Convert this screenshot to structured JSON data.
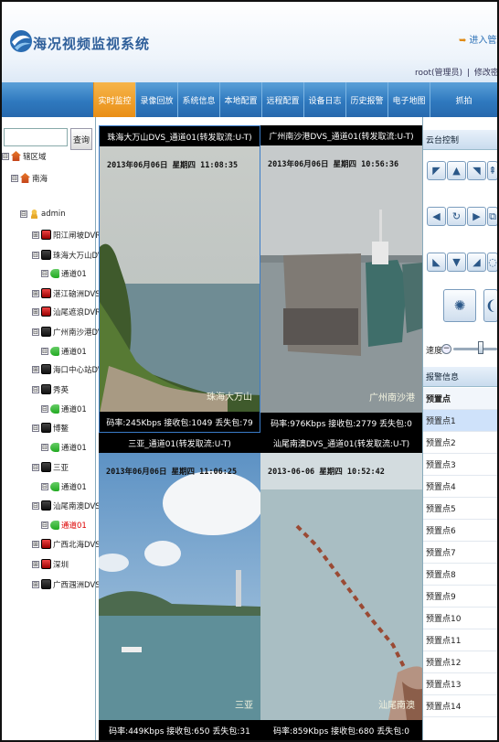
{
  "header": {
    "app_title": "海况视频监视系统",
    "enter_admin": "进入管理",
    "user_name": "root(管理员)",
    "change_password": "修改密码",
    "separator": "|"
  },
  "nav": {
    "tabs": [
      {
        "label": "实时监控",
        "active": true
      },
      {
        "label": "录像回放"
      },
      {
        "label": "系统信息"
      },
      {
        "label": "本地配置"
      },
      {
        "label": "远程配置"
      },
      {
        "label": "设备日志"
      },
      {
        "label": "历史报警"
      },
      {
        "label": "电子地图"
      },
      {
        "label": "抓拍"
      }
    ]
  },
  "left": {
    "search_placeholder": "",
    "search_button": "查询",
    "tree": [
      {
        "label": "辖区域",
        "icon": "house-icon",
        "expander": "⊟"
      },
      {
        "label": "南海",
        "icon": "house-icon",
        "expander": "⊟"
      },
      {
        "label": "admin",
        "icon": "user-icon",
        "expander": "⊟"
      },
      {
        "label": "阳江闸坡DVR",
        "icon": "dvr-icon",
        "expander": "⊞"
      },
      {
        "label": "珠海大万山DVS",
        "icon": "dvr-icon",
        "expander": "⊟"
      },
      {
        "label": "通道01",
        "icon": "camera-icon",
        "expander": "⊟"
      },
      {
        "label": "湛江硇洲DVS",
        "icon": "dvr-icon",
        "expander": "⊞"
      },
      {
        "label": "汕尾遮浪DVR",
        "icon": "dvr-icon",
        "expander": "⊞"
      },
      {
        "label": "广州南沙港DVS",
        "icon": "dvr-icon",
        "expander": "⊟"
      },
      {
        "label": "通道01",
        "icon": "camera-icon",
        "expander": "⊟"
      },
      {
        "label": "海口中心站DVR",
        "icon": "dvr-icon",
        "expander": "⊞"
      },
      {
        "label": "秀英",
        "icon": "dvr-icon",
        "expander": "⊟"
      },
      {
        "label": "通道01",
        "icon": "camera-icon",
        "expander": "⊟"
      },
      {
        "label": "博鳌",
        "icon": "dvr-icon",
        "expander": "⊟"
      },
      {
        "label": "通道01",
        "icon": "camera-icon",
        "expander": "⊟"
      },
      {
        "label": "三亚",
        "icon": "dvr-icon",
        "expander": "⊟"
      },
      {
        "label": "通道01",
        "icon": "camera-icon",
        "expander": "⊟"
      },
      {
        "label": "汕尾南澳DVS",
        "icon": "dvr-icon",
        "expander": "⊟"
      },
      {
        "label": "通道01",
        "icon": "camera-icon",
        "expander": "⊟",
        "red": true
      },
      {
        "label": "广西北海DVS",
        "icon": "dvr-icon",
        "expander": "⊞"
      },
      {
        "label": "深圳",
        "icon": "dvr-icon",
        "expander": "⊞"
      },
      {
        "label": "广西涠洲DVS",
        "icon": "dvr-icon",
        "expander": "⊞"
      }
    ]
  },
  "videos": [
    {
      "title": "珠海大万山DVS_通道01(转发取流:U-T)",
      "timestamp": "2013年06月06日 星期四 11:08:35",
      "place": "珠海大万山",
      "footer": "码率:245Kbps 接收包:1049 丢失包:79"
    },
    {
      "title": "广州南沙港DVS_通道01(转发取流:U-T)",
      "timestamp": "2013年06月06日 星期四 10:56:36",
      "place": "广州南沙港",
      "footer": "码率:976Kbps 接收包:2779 丢失包:0"
    },
    {
      "title": "三亚_通道01(转发取流:U-T)",
      "timestamp": "2013年06月06日 星期四 11:06:25",
      "place": "三亚",
      "footer": "码率:449Kbps 接收包:650 丢失包:31"
    },
    {
      "title": "汕尾南澳DVS_通道01(转发取流:U-T)",
      "timestamp": "2013-06-06 星期四 10:52:42",
      "place": "汕尾南澳",
      "footer": "码率:859Kbps 接收包:680 丢失包:0"
    }
  ],
  "right": {
    "ptz_title": "云台控制",
    "speed_label": "速度",
    "speed_minus": "−",
    "speed_value": 0.6,
    "alarm_title": "报警信息",
    "alarm_header": "预置点",
    "presets": [
      "预置点1",
      "预置点2",
      "预置点3",
      "预置点4",
      "预置点5",
      "预置点6",
      "预置点7",
      "预置点8",
      "预置点9",
      "预置点10",
      "预置点11",
      "预置点12",
      "预置点13",
      "预置点14"
    ],
    "ptz_buttons": [
      {
        "name": "ptz-up-left-icon",
        "glyph": "◤"
      },
      {
        "name": "ptz-up-icon",
        "glyph": "▲"
      },
      {
        "name": "ptz-up-right-icon",
        "glyph": "◥"
      },
      {
        "name": "ptz-zoom-in-icon",
        "glyph": "⇞"
      },
      {
        "name": "ptz-left-icon",
        "glyph": "◀"
      },
      {
        "name": "ptz-auto-icon",
        "glyph": "↻"
      },
      {
        "name": "ptz-right-icon",
        "glyph": "▶"
      },
      {
        "name": "ptz-focus-icon",
        "glyph": "⧉"
      },
      {
        "name": "ptz-down-left-icon",
        "glyph": "◣"
      },
      {
        "name": "ptz-down-icon",
        "glyph": "▼"
      },
      {
        "name": "ptz-down-right-icon",
        "glyph": "◢"
      },
      {
        "name": "ptz-iris-icon",
        "glyph": "◌"
      },
      {
        "name": "ptz-light-icon",
        "glyph": "✺"
      },
      {
        "name": "ptz-wiper-icon",
        "glyph": "❨"
      }
    ]
  }
}
